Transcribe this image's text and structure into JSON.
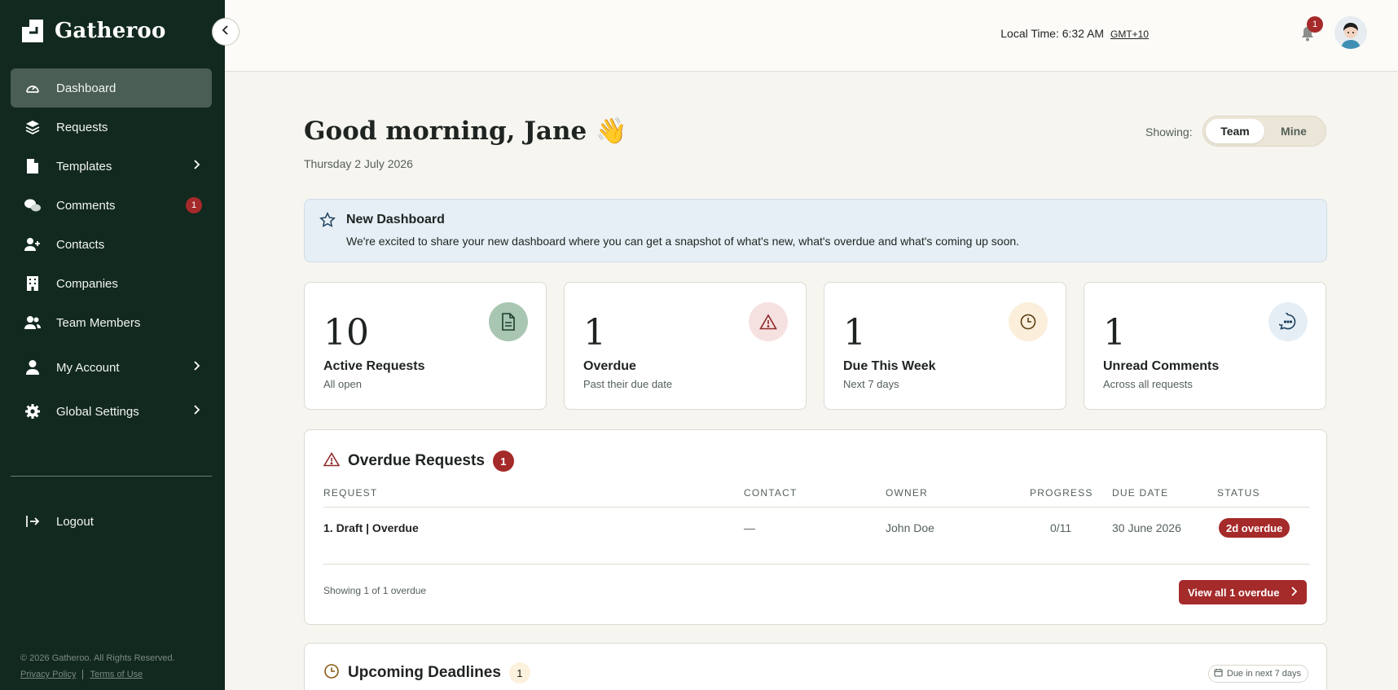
{
  "app": {
    "name": "Gatheroo"
  },
  "sidebar": {
    "items": [
      {
        "label": "Dashboard",
        "icon": "gauge-icon",
        "active": true
      },
      {
        "label": "Requests",
        "icon": "layers-icon"
      },
      {
        "label": "Templates",
        "icon": "file-icon",
        "has_submenu": true
      },
      {
        "label": "Comments",
        "icon": "chat-bubbles-icon",
        "badge": "1"
      },
      {
        "label": "Contacts",
        "icon": "user-plus-icon"
      },
      {
        "label": "Companies",
        "icon": "building-icon"
      },
      {
        "label": "Team Members",
        "icon": "users-icon"
      },
      {
        "label": "My Account",
        "icon": "user-icon",
        "has_submenu": true
      },
      {
        "label": "Global Settings",
        "icon": "gear-icon",
        "has_submenu": true
      }
    ],
    "logout_label": "Logout",
    "footer": {
      "copyright": "© 2026 Gatheroo. All Rights Reserved.",
      "privacy": "Privacy Policy",
      "terms": "Terms of Use"
    }
  },
  "header": {
    "local_time_label": "Local Time: 6:32 AM",
    "timezone": "GMT+10",
    "notifications_count": "1"
  },
  "main": {
    "greeting": "Good morning, Jane 👋",
    "date": "Thursday 2 July 2026",
    "showing_label": "Showing:",
    "scope_options": [
      "Team",
      "Mine"
    ],
    "scope_selected": "Team",
    "banner": {
      "title": "New Dashboard",
      "text": "We're excited to share your new dashboard where you can get a snapshot of what's new, what's overdue and what's coming up soon."
    },
    "stats": [
      {
        "value": "10",
        "label": "Active Requests",
        "sub": "All open",
        "icon": "document-icon",
        "color": "#a9c6b3"
      },
      {
        "value": "1",
        "label": "Overdue",
        "sub": "Past their due date",
        "icon": "warning-icon",
        "color": "#f6e1e1"
      },
      {
        "value": "1",
        "label": "Due This Week",
        "sub": "Next 7 days",
        "icon": "clock-icon",
        "color": "#fbefdc"
      },
      {
        "value": "1",
        "label": "Unread Comments",
        "sub": "Across all requests",
        "icon": "chat-icon",
        "color": "#e6eef5"
      }
    ],
    "overdue": {
      "title": "Overdue Requests",
      "count": "1",
      "columns": [
        "REQUEST",
        "CONTACT",
        "OWNER",
        "PROGRESS",
        "DUE DATE",
        "STATUS"
      ],
      "rows": [
        {
          "request": "1. Draft | Overdue",
          "contact": "—",
          "owner": "John Doe",
          "progress": "0/11",
          "due_date": "30 June 2026",
          "status": "2d overdue"
        }
      ],
      "footer_text": "Showing 1 of 1 overdue",
      "view_all_label": "View all 1 overdue"
    },
    "upcoming": {
      "title": "Upcoming Deadlines",
      "count": "1",
      "chip_label": "Due in next 7 days"
    }
  },
  "colors": {
    "sidebar_bg": "#12291f",
    "accent_red": "#a52a2a",
    "page_bg": "#f6f5f0",
    "banner_bg": "#e6eff5"
  }
}
